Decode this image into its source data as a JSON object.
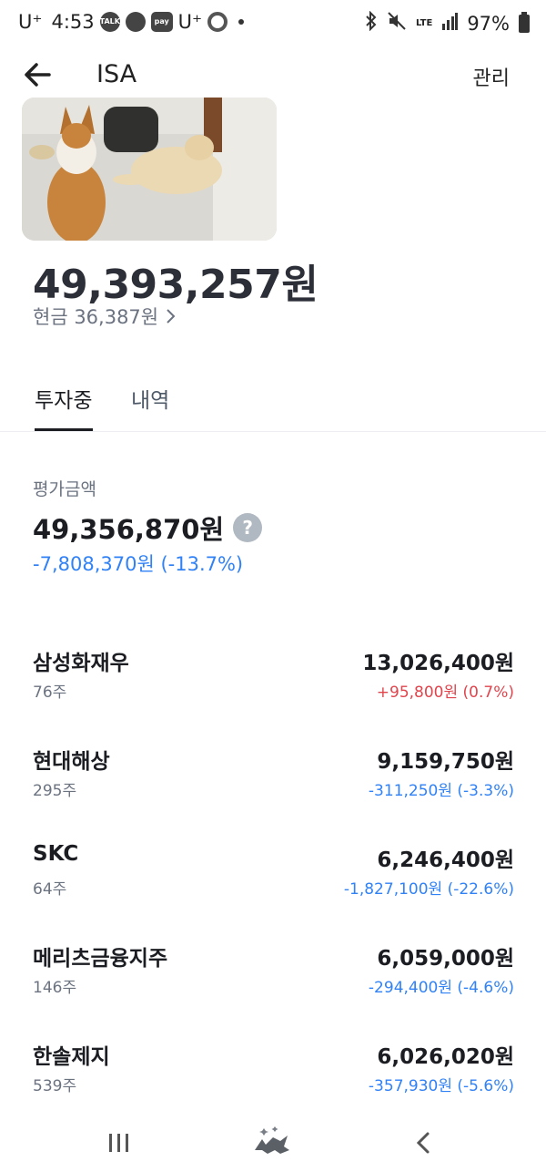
{
  "status_bar": {
    "carrier": "U⁺",
    "time": "4:53",
    "icons": [
      "talk-icon",
      "chat-bubble-icon",
      "pay-icon",
      "uplus-icon",
      "chrome-icon",
      "notification-dot"
    ],
    "right_icons": [
      "bluetooth-icon",
      "mute-icon",
      "lte-icon",
      "signal-icon",
      "battery-icon"
    ],
    "lte": "LTE",
    "battery": "97%"
  },
  "header": {
    "title": "ISA",
    "manage_label": "관리"
  },
  "account": {
    "total": "49,393,257원",
    "cash_label": "현금 36,387원"
  },
  "tabs": [
    {
      "label": "투자중",
      "active": true
    },
    {
      "label": "내역",
      "active": false
    }
  ],
  "evaluation": {
    "label": "평가금액",
    "amount": "49,356,870원",
    "change": "-7,808,370원 (-13.7%)"
  },
  "holdings": [
    {
      "name": "삼성화재우",
      "qty": "76주",
      "value": "13,026,400원",
      "change": "+95,800원 (0.7%)",
      "direction": "up"
    },
    {
      "name": "현대해상",
      "qty": "295주",
      "value": "9,159,750원",
      "change": "-311,250원 (-3.3%)",
      "direction": "down"
    },
    {
      "name": "SKC",
      "qty": "64주",
      "value": "6,246,400원",
      "change": "-1,827,100원 (-22.6%)",
      "direction": "down"
    },
    {
      "name": "메리츠금융지주",
      "qty": "146주",
      "value": "6,059,000원",
      "change": "-294,400원 (-4.6%)",
      "direction": "down"
    },
    {
      "name": "한솔제지",
      "qty": "539주",
      "value": "6,026,020원",
      "change": "-357,930원 (-5.6%)",
      "direction": "down"
    }
  ],
  "colors": {
    "up": "#e0454d",
    "down": "#3182f6",
    "text_primary": "#1b1d22",
    "text_secondary": "#6b7280"
  },
  "nav": [
    "recent-apps-icon",
    "home-fox-icon",
    "back-icon"
  ]
}
